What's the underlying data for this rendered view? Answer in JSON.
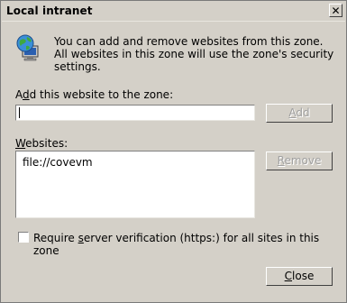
{
  "window": {
    "title": "Local intranet",
    "close_glyph": "✕"
  },
  "info": {
    "text": "You can add and remove websites from this zone. All websites in this zone will use the zone's security settings."
  },
  "add_section": {
    "label_prefix": "A",
    "label_underlined": "d",
    "label_suffix": "d this website to the zone:",
    "input_value": "",
    "add_button_underlined": "A",
    "add_button_rest": "dd"
  },
  "websites_section": {
    "label_underlined": "W",
    "label_rest": "ebsites:",
    "items": [
      "file://covevm"
    ],
    "remove_button_underlined": "R",
    "remove_button_rest": "emove"
  },
  "verification": {
    "checked": false,
    "label_prefix": "Require ",
    "label_underlined": "s",
    "label_suffix": "erver verification (https:) for all sites in this zone"
  },
  "footer": {
    "close_button_underlined": "C",
    "close_button_rest": "lose"
  },
  "icons": {
    "zone_icon": "globe-monitor-icon"
  }
}
